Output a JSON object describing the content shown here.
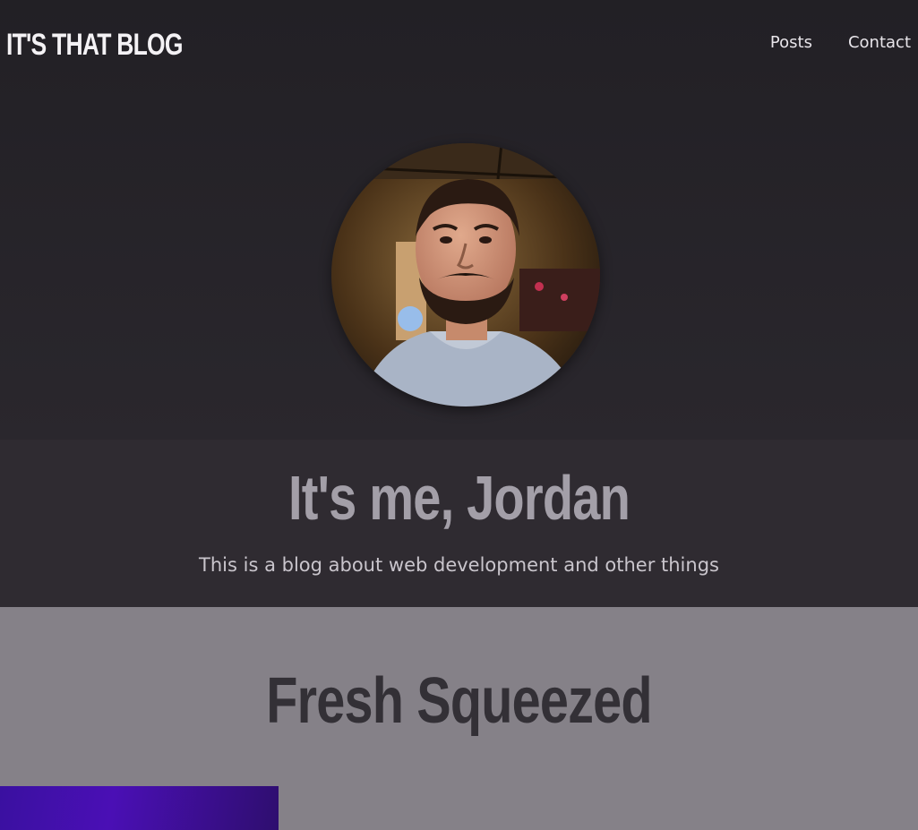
{
  "header": {
    "brand": "IT'S THAT BLOG",
    "nav": [
      {
        "label": "Posts"
      },
      {
        "label": "Contact"
      }
    ]
  },
  "intro": {
    "title": "It's me, Jordan",
    "subtitle": "This is a blog about web development and other things"
  },
  "section": {
    "title": "Fresh Squeezed"
  },
  "colors": {
    "header_bg": "#222025",
    "intro_bg": "#2f2b31",
    "section_bg": "#858188",
    "card_accent": "#4a0fb5"
  }
}
